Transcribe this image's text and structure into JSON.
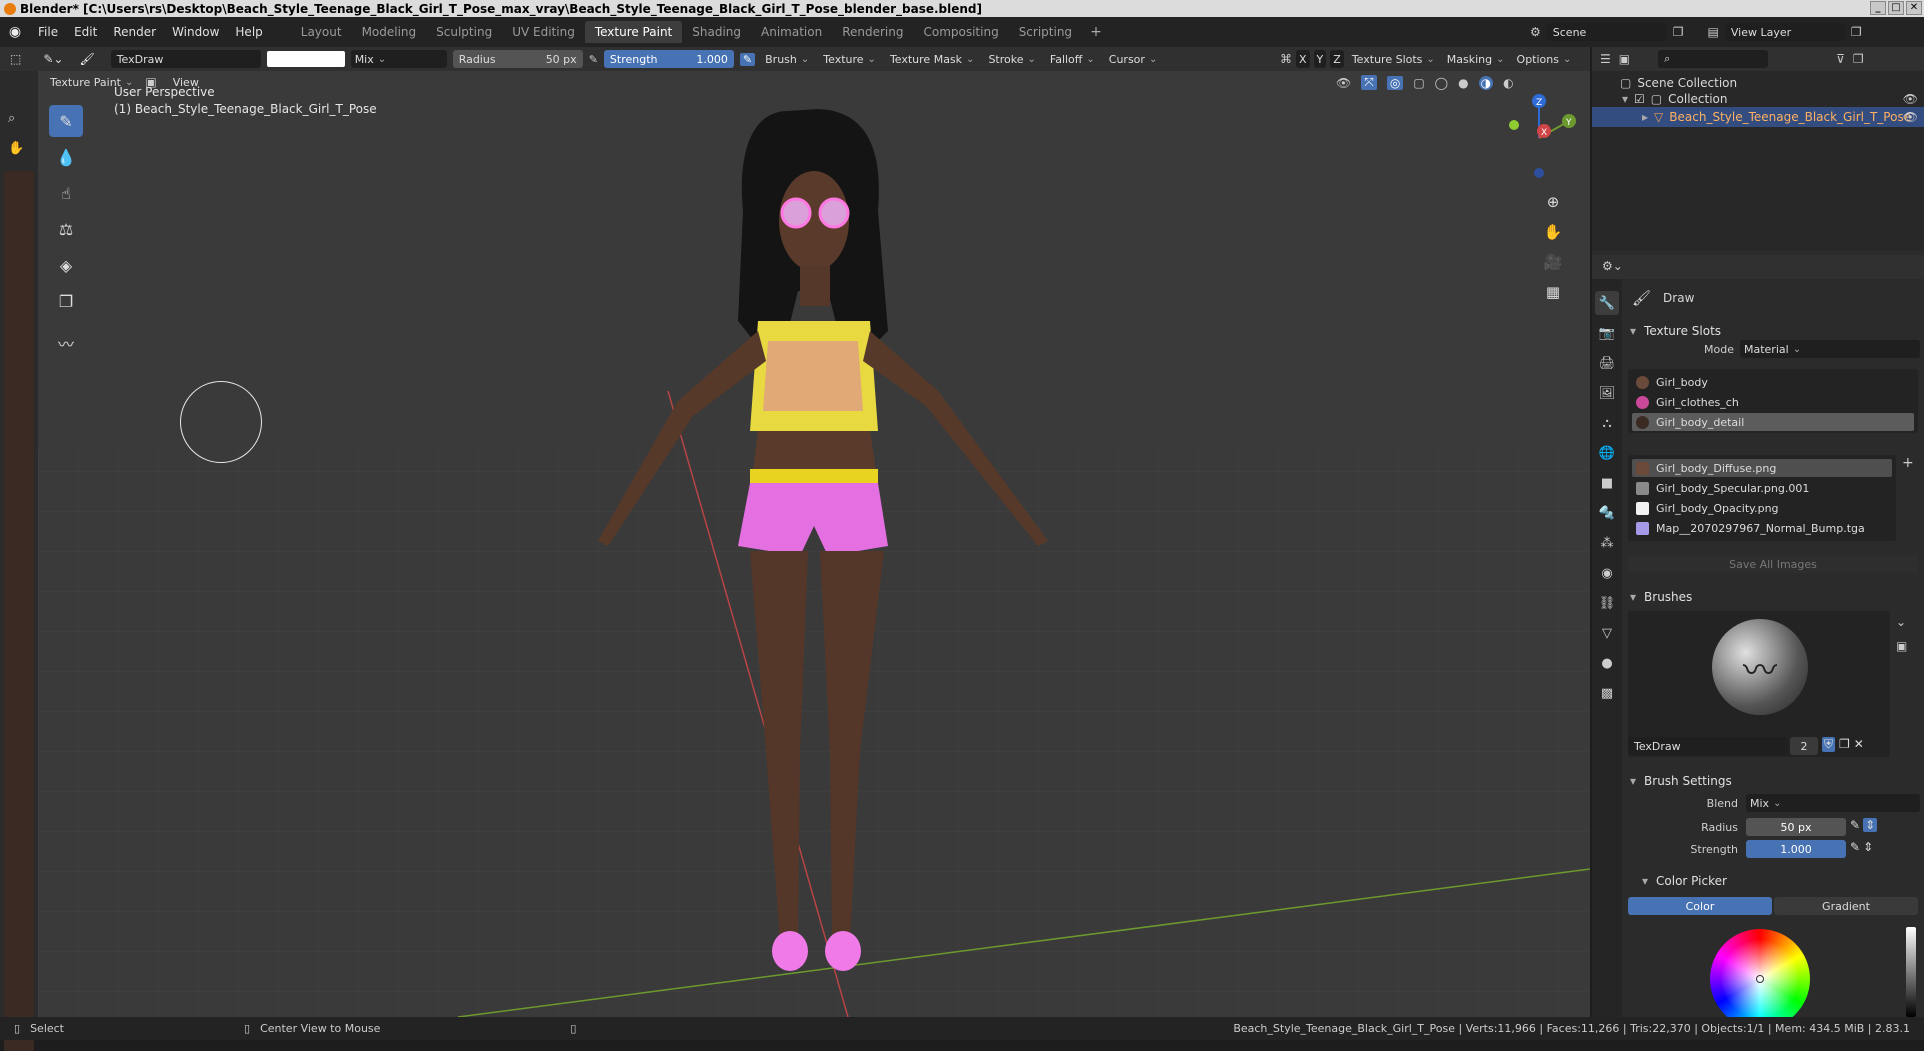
{
  "window": {
    "title": "Blender* [C:\\Users\\rs\\Desktop\\Beach_Style_Teenage_Black_Girl_T_Pose_max_vray\\Beach_Style_Teenage_Black_Girl_T_Pose_blender_base.blend]"
  },
  "menu": [
    "File",
    "Edit",
    "Render",
    "Window",
    "Help"
  ],
  "workspaces": [
    "Layout",
    "Modeling",
    "Sculpting",
    "UV Editing",
    "Texture Paint",
    "Shading",
    "Animation",
    "Rendering",
    "Compositing",
    "Scripting"
  ],
  "active_workspace": "Texture Paint",
  "scene": {
    "name": "Scene",
    "view_layer": "View Layer"
  },
  "tool_header": {
    "brush_name": "TexDraw",
    "blend": "Mix",
    "radius_label": "Radius",
    "radius_value": "50 px",
    "strength_label": "Strength",
    "strength_value": "1.000",
    "menus": [
      "Brush",
      "Texture",
      "Texture Mask",
      "Stroke",
      "Falloff",
      "Cursor"
    ],
    "axes": [
      "X",
      "Y",
      "Z"
    ],
    "right_menus": [
      "Texture Slots",
      "Masking",
      "Options"
    ],
    "color": "#ffffff"
  },
  "view_header": {
    "mode": "Texture Paint",
    "view": "View"
  },
  "viewport": {
    "perspective": "User Perspective",
    "object": "(1) Beach_Style_Teenage_Black_Girl_T_Pose"
  },
  "gizmo": {
    "x": "X",
    "y": "Y",
    "z": "Z"
  },
  "outliner": {
    "scene_collection": "Scene Collection",
    "collection": "Collection",
    "object": "Beach_Style_Teenage_Black_Girl_T_Pose"
  },
  "properties": {
    "tool_name": "Draw",
    "texture_slots": {
      "title": "Texture Slots",
      "mode_label": "Mode",
      "mode_value": "Material",
      "materials": [
        "Girl_body",
        "Girl_clothes_ch",
        "Girl_body_detail"
      ],
      "images": [
        "Girl_body_Diffuse.png",
        "Girl_body_Specular.png.001",
        "Girl_body_Opacity.png",
        "Map__2070297967_Normal_Bump.tga"
      ],
      "save_all": "Save All Images"
    },
    "brushes": {
      "title": "Brushes",
      "name": "TexDraw",
      "users": "2"
    },
    "brush_settings": {
      "title": "Brush Settings",
      "blend_label": "Blend",
      "blend_value": "Mix",
      "radius_label": "Radius",
      "radius_value": "50 px",
      "strength_label": "Strength",
      "strength_value": "1.000"
    },
    "color_picker": {
      "title": "Color Picker",
      "tab_color": "Color",
      "tab_gradient": "Gradient"
    }
  },
  "status": {
    "select": "Select",
    "center_view": "Center View to Mouse",
    "info": "Beach_Style_Teenage_Black_Girl_T_Pose | Verts:11,966 | Faces:11,266 | Tris:22,370 | Objects:1/1 | Mem: 434.5 MiB | 2.83.1"
  },
  "colors": {
    "accent": "#4772b3",
    "selection": "#334d80",
    "viewport_bg": "#3a3a3a"
  }
}
